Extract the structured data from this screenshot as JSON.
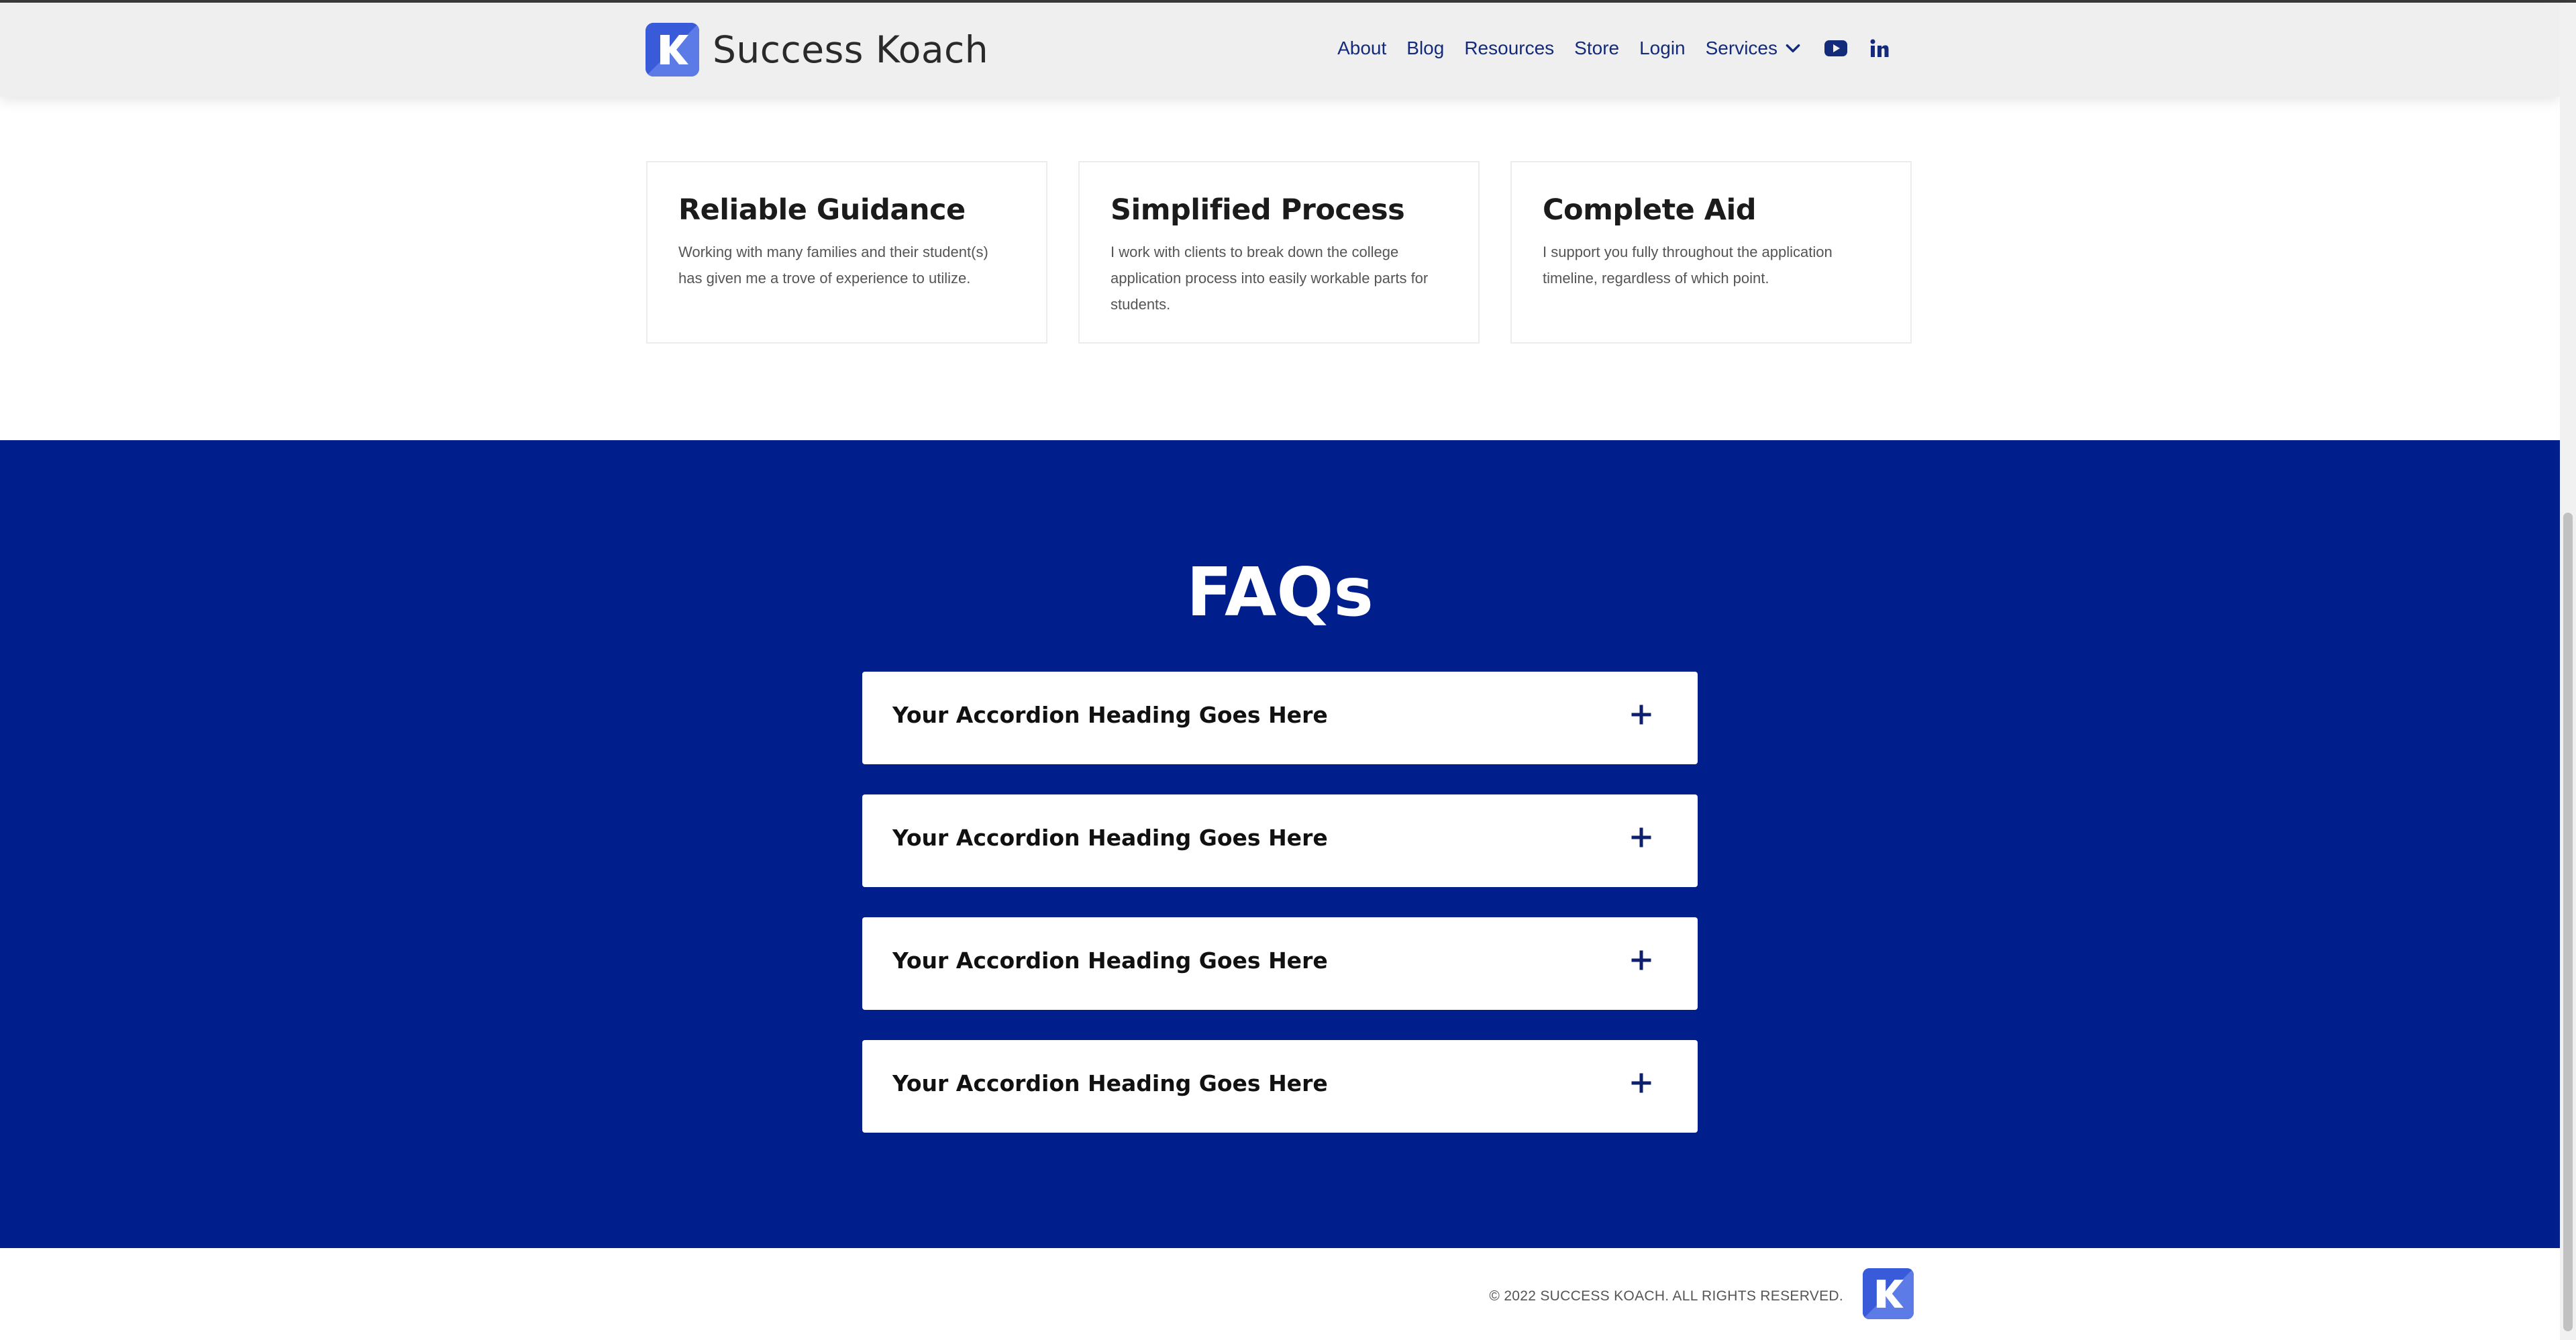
{
  "header": {
    "brand_name": "Success Koach",
    "logo_icon": "k-logo-icon",
    "nav": {
      "about": "About",
      "blog": "Blog",
      "resources": "Resources",
      "store": "Store",
      "login": "Login",
      "services": "Services"
    },
    "social_icons": [
      "youtube-icon",
      "linkedin-icon"
    ]
  },
  "features": [
    {
      "title": "Reliable Guidance",
      "text": "Working with many families and their student(s) has given me a trove of experience to utilize."
    },
    {
      "title": "Simplified Process",
      "text": "I work with clients to break down the college application process into easily workable parts for students."
    },
    {
      "title": "Complete Aid",
      "text": "I support you fully throughout the application timeline, regardless of which point."
    }
  ],
  "faq": {
    "title": "FAQs",
    "items": [
      {
        "heading": "Your Accordion Heading Goes Here"
      },
      {
        "heading": "Your Accordion Heading Goes Here"
      },
      {
        "heading": "Your Accordion Heading Goes Here"
      },
      {
        "heading": "Your Accordion Heading Goes Here"
      }
    ]
  },
  "footer": {
    "copyright": "© 2022 SUCCESS KOACH. ALL RIGHTS RESERVED."
  },
  "colors": {
    "brand_blue": "#3a5bd9",
    "nav_text": "#142a7a",
    "faq_background": "#001f8c"
  }
}
